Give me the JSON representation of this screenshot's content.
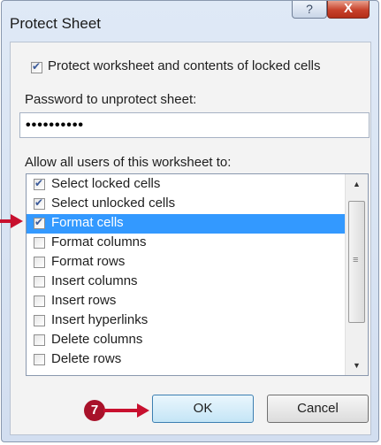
{
  "window": {
    "title": "Protect Sheet",
    "help_label": "?",
    "close_label": "X"
  },
  "protect_checkbox": {
    "label": "Protect worksheet and contents of locked cells",
    "checked": true
  },
  "password": {
    "label": "Password to unprotect sheet:",
    "value": "••••••••••"
  },
  "permissions": {
    "label": "Allow all users of this worksheet to:",
    "items": [
      {
        "label": "Select locked cells",
        "checked": true
      },
      {
        "label": "Select unlocked cells",
        "checked": true
      },
      {
        "label": "Format cells",
        "checked": true,
        "selected": true
      },
      {
        "label": "Format columns",
        "checked": false
      },
      {
        "label": "Format rows",
        "checked": false
      },
      {
        "label": "Insert columns",
        "checked": false
      },
      {
        "label": "Insert rows",
        "checked": false
      },
      {
        "label": "Insert hyperlinks",
        "checked": false
      },
      {
        "label": "Delete columns",
        "checked": false
      },
      {
        "label": "Delete rows",
        "checked": false
      }
    ]
  },
  "scrollbar": {
    "up_icon": "▲",
    "down_icon": "▼",
    "grip_icon": "≡"
  },
  "buttons": {
    "ok_label": "OK",
    "cancel_label": "Cancel"
  },
  "annotation": {
    "step_badge": "7"
  },
  "colors": {
    "selection": "#3399ff",
    "annotation_red": "#c8102e",
    "close_red": "#c7412a"
  }
}
